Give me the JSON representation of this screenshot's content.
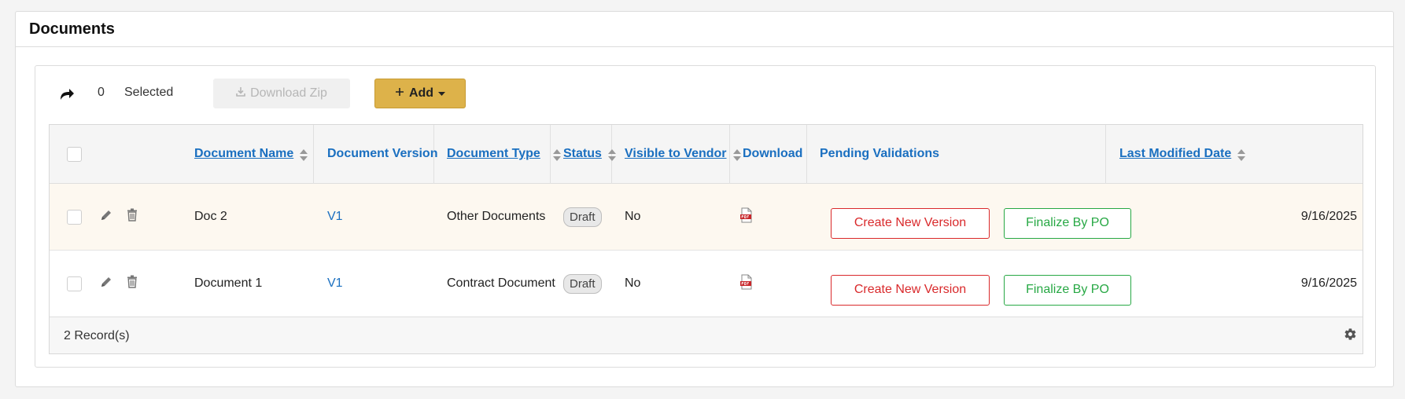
{
  "panel": {
    "title": "Documents"
  },
  "toolbar": {
    "selected_count": "0",
    "selected_label": "Selected",
    "download_zip_label": "Download Zip",
    "add_label": "Add"
  },
  "table": {
    "columns": {
      "document_name": "Document Name",
      "document_version": "Document Version",
      "document_type": "Document Type",
      "status": "Status",
      "visible_to_vendor": "Visible to Vendor",
      "download": "Download",
      "pending_validations": "Pending Validations",
      "last_modified_date": "Last Modified Date"
    },
    "rows": [
      {
        "name": "Doc 2",
        "version": "V1",
        "type": "Other Documents",
        "status": "Draft",
        "visible_to_vendor": "No",
        "action_create": "Create New Version",
        "action_finalize": "Finalize By PO",
        "last_modified": "9/16/2025"
      },
      {
        "name": "Document 1",
        "version": "V1",
        "type": "Contract Document",
        "status": "Draft",
        "visible_to_vendor": "No",
        "action_create": "Create New Version",
        "action_finalize": "Finalize By PO",
        "last_modified": "9/16/2025"
      }
    ],
    "footer": {
      "records": "2 Record(s)"
    }
  },
  "colors": {
    "accent_link": "#1a6fc0",
    "add_button": "#ddb24a",
    "danger": "#d9292b",
    "success": "#27a844",
    "highlight_row": "#fdf8f0"
  },
  "icons": {
    "share": "share-arrow-icon",
    "download_zip": "download-icon",
    "add": "plus-icon",
    "add_caret": "caret-down-icon",
    "edit": "pencil-icon",
    "delete": "trash-icon",
    "pdf": "pdf-file-icon",
    "sort": "sort-icon",
    "settings": "gear-icon"
  }
}
